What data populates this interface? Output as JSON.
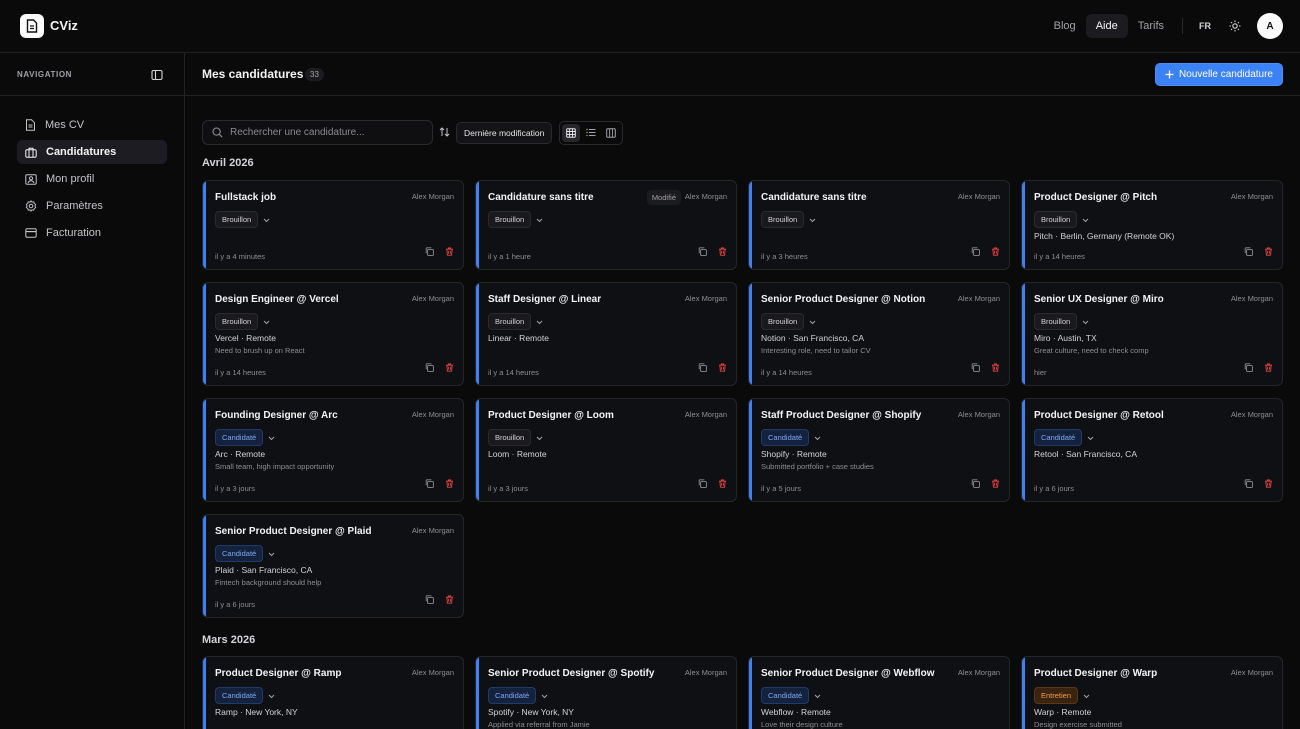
{
  "app": {
    "name": "CViz"
  },
  "header": {
    "links": [
      "Blog",
      "Aide",
      "Tarifs"
    ],
    "active_link": "Aide",
    "lang": "FR",
    "avatar_letter": "A"
  },
  "sidebar": {
    "title": "NAVIGATION",
    "items": [
      {
        "label": "Mes CV",
        "icon": "document-icon"
      },
      {
        "label": "Candidatures",
        "icon": "briefcase-icon",
        "active": true
      },
      {
        "label": "Mon profil",
        "icon": "profile-icon"
      },
      {
        "label": "Paramètres",
        "icon": "gear-icon"
      },
      {
        "label": "Facturation",
        "icon": "credit-card-icon"
      }
    ]
  },
  "main": {
    "title": "Mes candidatures",
    "count": "33",
    "new_button": "Nouvelle candidature",
    "search_placeholder": "Rechercher une candidature...",
    "sort_label": "Dernière modification",
    "sections": [
      {
        "label": "Avril 2026",
        "cards": [
          {
            "title": "Fullstack job",
            "author": "Alex Morgan",
            "status": "Brouillon",
            "time": "il y a 4 minutes"
          },
          {
            "title": "Candidature sans titre",
            "author": "Alex Morgan",
            "status": "Brouillon",
            "time": "il y a 1 heure",
            "modified": "Modifié"
          },
          {
            "title": "Candidature sans titre",
            "author": "Alex Morgan",
            "status": "Brouillon",
            "time": "il y a 3 heures"
          },
          {
            "title": "Product Designer @ Pitch",
            "author": "Alex Morgan",
            "status": "Brouillon",
            "company": "Pitch · Berlin, Germany (Remote OK)",
            "time": "il y a 14 heures"
          },
          {
            "title": "Design Engineer @ Vercel",
            "author": "Alex Morgan",
            "status": "Brouillon",
            "company": "Vercel · Remote",
            "note": "Need to brush up on React",
            "time": "il y a 14 heures"
          },
          {
            "title": "Staff Designer @ Linear",
            "author": "Alex Morgan",
            "status": "Brouillon",
            "company": "Linear · Remote",
            "time": "il y a 14 heures"
          },
          {
            "title": "Senior Product Designer @ Notion",
            "author": "Alex Morgan",
            "status": "Brouillon",
            "company": "Notion · San Francisco, CA",
            "note": "Interesting role, need to tailor CV",
            "time": "il y a 14 heures"
          },
          {
            "title": "Senior UX Designer @ Miro",
            "author": "Alex Morgan",
            "status": "Brouillon",
            "company": "Miro · Austin, TX",
            "note": "Great culture, need to check comp",
            "time": "hier"
          },
          {
            "title": "Founding Designer @ Arc",
            "author": "Alex Morgan",
            "status": "Candidaté",
            "company": "Arc · Remote",
            "note": "Small team, high impact opportunity",
            "time": "il y a 3 jours"
          },
          {
            "title": "Product Designer @ Loom",
            "author": "Alex Morgan",
            "status": "Brouillon",
            "company": "Loom · Remote",
            "time": "il y a 3 jours"
          },
          {
            "title": "Staff Product Designer @ Shopify",
            "author": "Alex Morgan",
            "status": "Candidaté",
            "company": "Shopify · Remote",
            "note": "Submitted portfolio + case studies",
            "time": "il y a 5 jours"
          },
          {
            "title": "Product Designer @ Retool",
            "author": "Alex Morgan",
            "status": "Candidaté",
            "company": "Retool · San Francisco, CA",
            "time": "il y a 6 jours"
          },
          {
            "title": "Senior Product Designer @ Plaid",
            "author": "Alex Morgan",
            "status": "Candidaté",
            "company": "Plaid · San Francisco, CA",
            "note": "Fintech background should help",
            "time": "il y a 6 jours"
          }
        ]
      },
      {
        "label": "Mars 2026",
        "cards": [
          {
            "title": "Product Designer @ Ramp",
            "author": "Alex Morgan",
            "status": "Candidaté",
            "company": "Ramp · New York, NY"
          },
          {
            "title": "Senior Product Designer @ Spotify",
            "author": "Alex Morgan",
            "status": "Candidaté",
            "company": "Spotify · New York, NY",
            "note": "Applied via referral from Jamie"
          },
          {
            "title": "Senior Product Designer @ Webflow",
            "author": "Alex Morgan",
            "status": "Candidaté",
            "company": "Webflow · Remote",
            "note": "Love their design culture"
          },
          {
            "title": "Product Designer @ Warp",
            "author": "Alex Morgan",
            "status": "Entretien",
            "company": "Warp · Remote",
            "note": "Design exercise submitted"
          }
        ]
      }
    ]
  },
  "colors": {
    "accent": "#3b82f6",
    "background": "#0a0a0b",
    "card": "#0f1014",
    "danger": "#ef4444"
  }
}
